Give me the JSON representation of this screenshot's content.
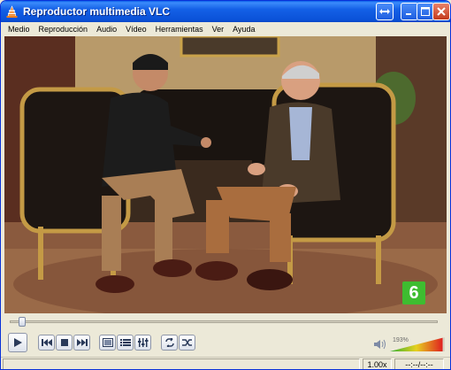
{
  "window": {
    "title": "Reproductor multimedia VLC"
  },
  "menu": [
    "Medio",
    "Reproducción",
    "Audio",
    "Vídeo",
    "Herramientas",
    "Ver",
    "Ayuda"
  ],
  "player": {
    "progress": 0.02,
    "channel_logo": "6",
    "volume_label": "193%",
    "volume_level": 0.96
  },
  "status": {
    "speed": "1.00x",
    "time": "--:--/--:--"
  },
  "icons": {
    "play": "play-icon",
    "prev": "previous-icon",
    "stop": "stop-icon",
    "next": "next-icon",
    "fullscreen": "fullscreen-icon",
    "playlist": "playlist-icon",
    "settings": "extended-settings-icon",
    "loop": "loop-icon",
    "random": "shuffle-icon",
    "volume": "speaker-icon"
  },
  "colors": {
    "titlebar": "#0b52d8",
    "window_bg": "#ece9d8",
    "close": "#c43b1c",
    "logo_green": "#3ebd30"
  }
}
